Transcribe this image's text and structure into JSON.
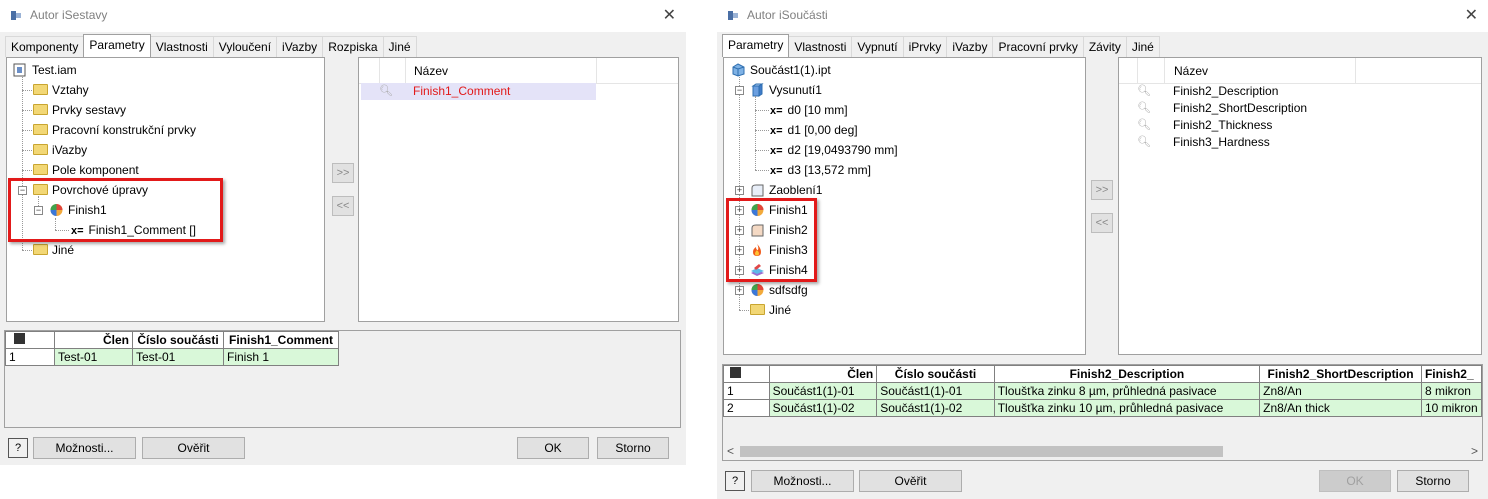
{
  "dialog_a": {
    "title": "Autor iSestavy",
    "close": "✕",
    "tabs": [
      "Komponenty",
      "Parametry",
      "Vlastnosti",
      "Vyloučení",
      "iVazby",
      "Rozpiska",
      "Jiné"
    ],
    "tree": {
      "root": "Test.iam",
      "items": [
        "Vztahy",
        "Prvky sestavy",
        "Pracovní konstrukční prvky",
        "iVazby",
        "Pole komponent",
        "Povrchové úpravy",
        "Finish1",
        "Finish1_Comment []",
        "Jiné"
      ],
      "x_eq": "x="
    },
    "add_arrow": ">>",
    "remove_arrow": "<<",
    "list": {
      "header": "Název",
      "rows": [
        "Finish1_Comment"
      ]
    },
    "table": {
      "headers": [
        "",
        "Člen",
        "Číslo součásti",
        "Finish1_Comment"
      ],
      "rows": [
        [
          "1",
          "Test-01",
          "Test-01",
          "Finish 1"
        ]
      ]
    },
    "buttons": {
      "help": "?",
      "options": "Možnosti...",
      "verify": "Ověřit",
      "ok": "OK",
      "cancel": "Storno"
    }
  },
  "dialog_b": {
    "title": "Autor iSoučásti",
    "close": "✕",
    "tabs": [
      "Parametry",
      "Vlastnosti",
      "Vypnutí",
      "iPrvky",
      "iVazby",
      "Pracovní prvky",
      "Závity",
      "Jiné"
    ],
    "tree": {
      "root": "Součást1(1).ipt",
      "extrude": "Vysunutí1",
      "params": [
        "d0 [10 mm]",
        "d1 [0,00 deg]",
        "d2 [19,0493790 mm]",
        "d3 [13,572 mm]"
      ],
      "x_eq": "x=",
      "fillet": "Zaoblení1",
      "finishes": [
        "Finish1",
        "Finish2",
        "Finish3",
        "Finish4"
      ],
      "other": "sdfsdfg",
      "folder": "Jiné"
    },
    "add_arrow": ">>",
    "remove_arrow": "<<",
    "list": {
      "header": "Název",
      "rows": [
        "Finish2_Description",
        "Finish2_ShortDescription",
        "Finish2_Thickness",
        "Finish3_Hardness"
      ]
    },
    "table": {
      "headers": [
        "",
        "Člen",
        "Číslo součásti",
        "Finish2_Description",
        "Finish2_ShortDescription",
        "Finish2_"
      ],
      "rows": [
        [
          "1",
          "Součást1(1)-01",
          "Součást1(1)-01",
          "Tloušťka zinku 8 µm, průhledná pasivace",
          "Zn8/An",
          "8 mikron"
        ],
        [
          "2",
          "Součást1(1)-02",
          "Součást1(1)-02",
          "Tloušťka zinku 10 µm, průhledná pasivace",
          "Zn8/An thick",
          "10 mikron"
        ]
      ]
    },
    "scroll_left": "<",
    "scroll_right": ">",
    "buttons": {
      "help": "?",
      "options": "Možnosti...",
      "verify": "Ověřit",
      "ok": "OK",
      "cancel": "Storno"
    }
  },
  "colors": {
    "highlight_box": "#e21a1a",
    "row_green": "#d9f8d9",
    "selected_item_text": "#e21a1a"
  }
}
